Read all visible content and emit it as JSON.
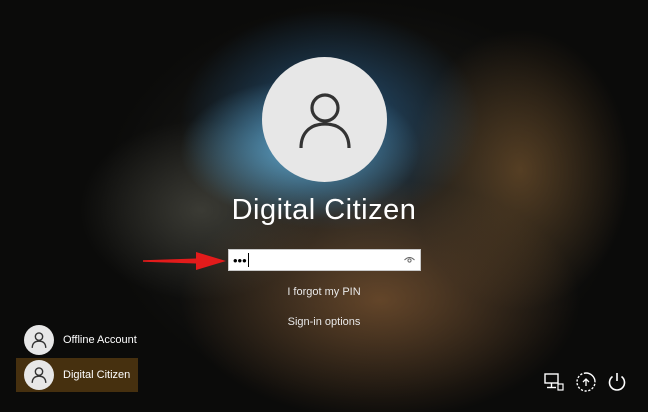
{
  "user": {
    "name": "Digital Citizen"
  },
  "pin": {
    "masked_value": "•••"
  },
  "links": {
    "forgot_pin": "I forgot my PIN",
    "sign_in_options": "Sign-in options"
  },
  "users": [
    {
      "label": "Offline Account",
      "selected": false
    },
    {
      "label": "Digital Citizen",
      "selected": true
    }
  ],
  "icons": {
    "avatar": "user-silhouette-icon",
    "reveal": "eye-icon",
    "annotation": "red-arrow",
    "network": "network-icon",
    "accessibility": "ease-of-access-icon",
    "power": "power-icon"
  },
  "colors": {
    "selected_user_bg": "#78501e",
    "arrow": "#e31b1b"
  }
}
